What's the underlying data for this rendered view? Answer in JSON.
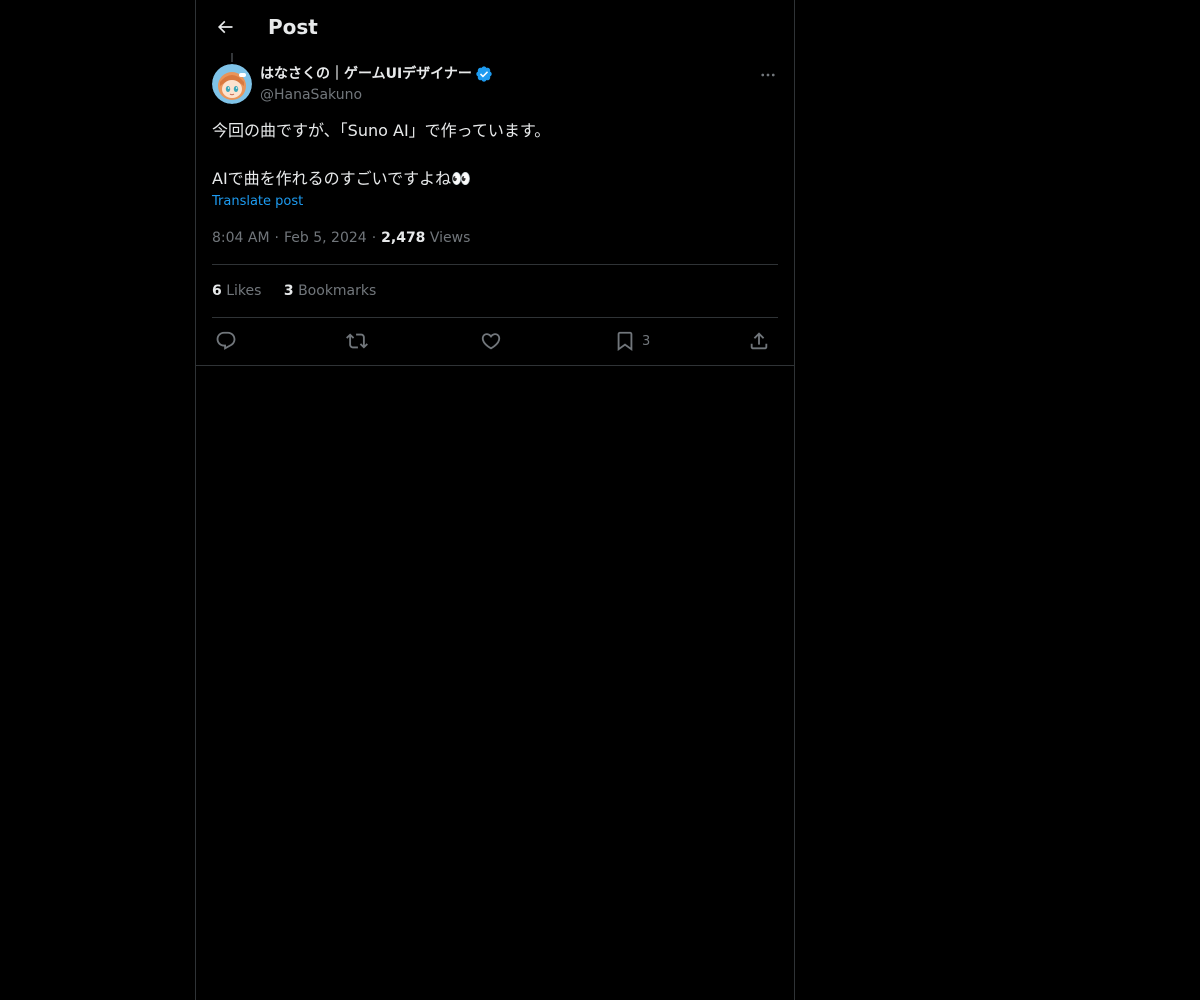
{
  "header": {
    "title": "Post"
  },
  "post": {
    "author": {
      "name": "はなさくの｜ゲームUIデザイナー",
      "handle": "@HanaSakuno",
      "verified": true
    },
    "text_lines": [
      "今回の曲ですが、「Suno AI」で作っています。",
      "",
      "AIで曲を作れるのすごいですよね👀"
    ],
    "translate_label": "Translate post",
    "time": "8:04 AM",
    "date": "Feb 5, 2024",
    "views_count": "2,478",
    "views_label": "Views",
    "likes_count": "6",
    "likes_label": "Likes",
    "bookmarks_count": "3",
    "bookmarks_label": "Bookmarks"
  },
  "actions": {
    "reply_icon": "reply-icon",
    "repost_icon": "repost-icon",
    "like_icon": "heart-icon",
    "bookmark_icon": "bookmark-icon",
    "bookmark_count": "3",
    "share_icon": "share-icon"
  },
  "colors": {
    "background": "#000000",
    "text_primary": "#e7e9ea",
    "text_secondary": "#71767b",
    "accent": "#1d9bf0",
    "border": "#2f3336"
  }
}
